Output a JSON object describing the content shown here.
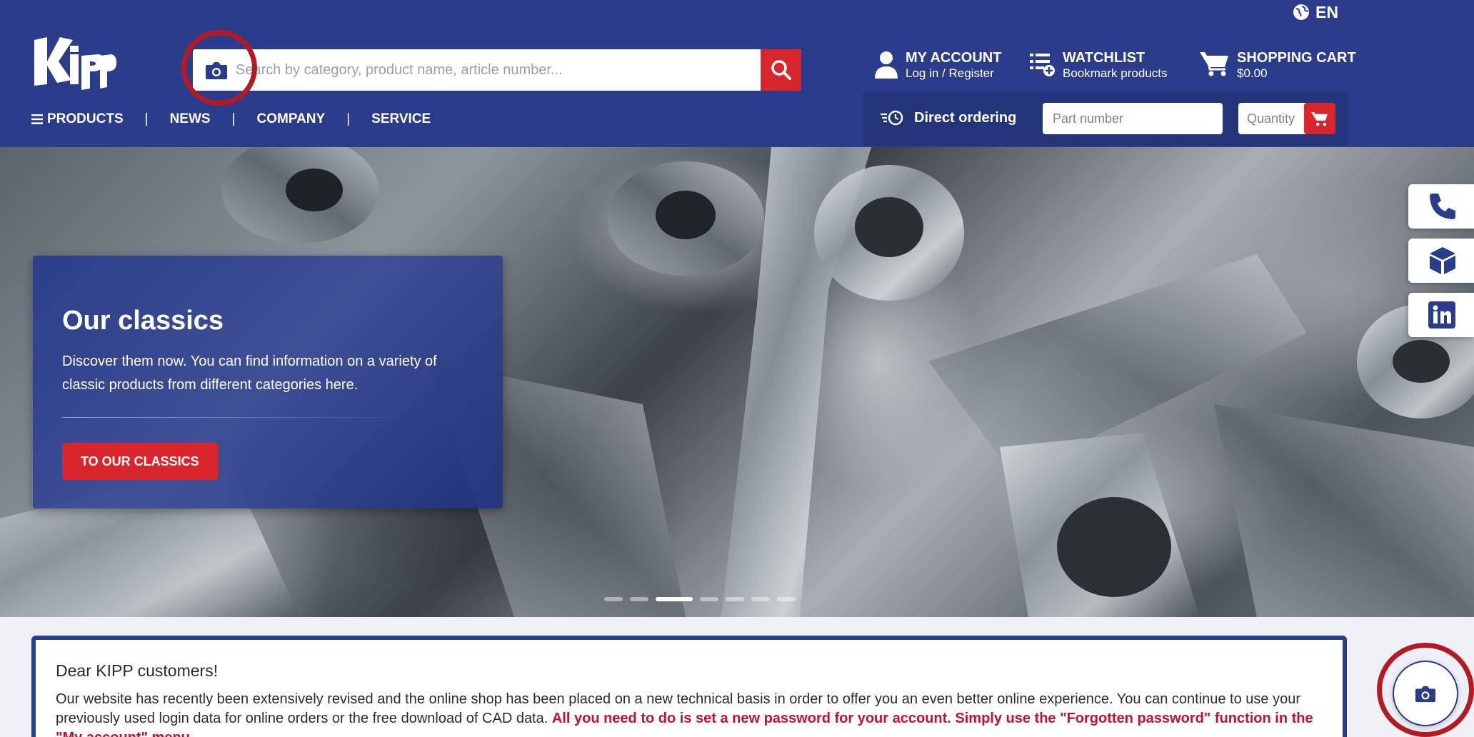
{
  "header": {
    "language": "EN",
    "search": {
      "placeholder": "Search by category, product name, article number..."
    },
    "account": {
      "title": "MY ACCOUNT",
      "subtitle": "Log in / Register"
    },
    "watchlist": {
      "title": "WATCHLIST",
      "subtitle": "Bookmark products"
    },
    "cart": {
      "title": "SHOPPING CART",
      "subtitle": "$0.00"
    },
    "nav": [
      {
        "label": "PRODUCTS"
      },
      {
        "label": "NEWS"
      },
      {
        "label": "COMPANY"
      },
      {
        "label": "SERVICE"
      }
    ],
    "nav_separator": "|",
    "direct": {
      "label": "Direct ordering",
      "part_placeholder": "Part number",
      "qty_placeholder": "Quantity"
    }
  },
  "hero": {
    "title": "Our classics",
    "text": "Discover them now. You can find information on a variety of classic products from different categories here.",
    "button": "TO OUR CLASSICS",
    "slide_count": 7,
    "active_slide": 3
  },
  "notice": {
    "title": "Dear KIPP customers!",
    "text": "Our website has recently been extensively revised and the online shop has been placed on a new technical basis in order to offer you an even better online experience. You can continue to use your previously used login data for online orders or the free download of CAD data.",
    "highlight": "All you need to do is set a new password for your account. Simply use the \"Forgotten password\" function in the \"My account\" menu."
  },
  "colors": {
    "header_bg": "#2a3c8a",
    "accent_red": "#d9252c",
    "highlight_red": "#c8102e"
  }
}
